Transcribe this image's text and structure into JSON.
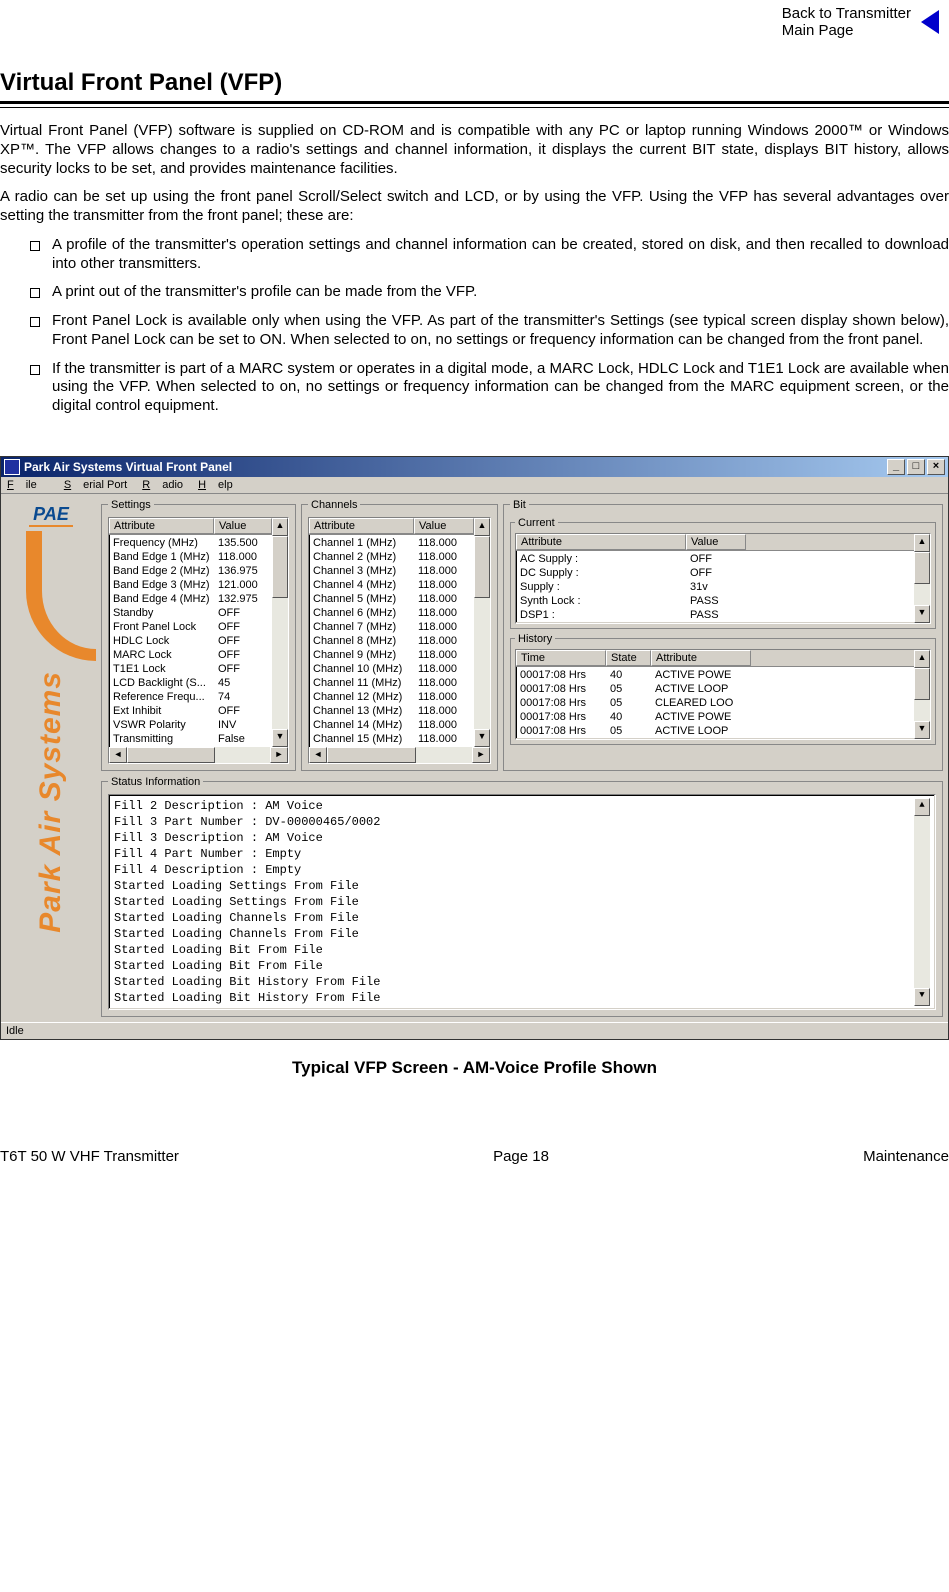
{
  "toplink": {
    "line1": "Back to Transmitter",
    "line2": "Main Page"
  },
  "title": "Virtual Front Panel (VFP)",
  "para1": "Virtual Front Panel (VFP) software is supplied on CD-ROM and is compatible with any PC or laptop running Windows 2000™ or Windows XP™. The VFP allows changes to a radio's settings and channel information, it displays the current BIT state, displays BIT history, allows security locks to be set, and provides maintenance facilities.",
  "para2": "A radio can be set up using the front panel Scroll/Select switch and LCD, or by using the VFP. Using the VFP has several advantages over setting the transmitter from the front panel; these are:",
  "bullets": [
    "A profile of the transmitter's operation settings and channel information can be created, stored on disk, and then recalled to download into other transmitters.",
    "A print out of the transmitter's profile can be made from the VFP.",
    "Front Panel Lock is available only when using the VFP. As part of the transmitter's Settings (see typical screen display shown below), Front Panel Lock can be set to ON. When selected to on, no settings or frequency information can be changed from the front panel.",
    "If the transmitter is part of a MARC system or operates in a digital mode, a MARC Lock, HDLC Lock and T1E1 Lock are available when using the VFP. When selected to on, no settings or frequency information can be changed from the MARC equipment screen, or the digital control equipment."
  ],
  "app": {
    "title": "Park Air Systems Virtual Front Panel",
    "menu": {
      "file": "File",
      "serial": "Serial Port",
      "radio": "Radio",
      "help": "Help"
    },
    "sidebar": {
      "logo": "PAE",
      "brand": "Park Air Systems"
    },
    "settings": {
      "legend": "Settings",
      "headA": "Attribute",
      "headB": "Value",
      "rows": [
        {
          "a": "Frequency (MHz)",
          "b": "135.500"
        },
        {
          "a": "Band Edge 1 (MHz)",
          "b": "118.000"
        },
        {
          "a": "Band Edge 2 (MHz)",
          "b": "136.975"
        },
        {
          "a": "Band Edge 3 (MHz)",
          "b": "121.000"
        },
        {
          "a": "Band Edge 4 (MHz)",
          "b": "132.975"
        },
        {
          "a": "Standby",
          "b": "OFF"
        },
        {
          "a": "Front Panel Lock",
          "b": "OFF"
        },
        {
          "a": "HDLC Lock",
          "b": "OFF"
        },
        {
          "a": "MARC Lock",
          "b": "OFF"
        },
        {
          "a": "T1E1 Lock",
          "b": "OFF"
        },
        {
          "a": "LCD Backlight (S...",
          "b": "45"
        },
        {
          "a": "Reference Frequ...",
          "b": "74"
        },
        {
          "a": "Ext Inhibit",
          "b": "OFF"
        },
        {
          "a": "VSWR Polarity",
          "b": "INV"
        },
        {
          "a": "Transmitting",
          "b": "False"
        }
      ]
    },
    "channels": {
      "legend": "Channels",
      "headA": "Attribute",
      "headB": "Value",
      "rows": [
        {
          "a": "Channel 1   (MHz)",
          "b": "118.000"
        },
        {
          "a": "Channel 2   (MHz)",
          "b": "118.000"
        },
        {
          "a": "Channel 3   (MHz)",
          "b": "118.000"
        },
        {
          "a": "Channel 4   (MHz)",
          "b": "118.000"
        },
        {
          "a": "Channel 5   (MHz)",
          "b": "118.000"
        },
        {
          "a": "Channel 6   (MHz)",
          "b": "118.000"
        },
        {
          "a": "Channel 7   (MHz)",
          "b": "118.000"
        },
        {
          "a": "Channel 8   (MHz)",
          "b": "118.000"
        },
        {
          "a": "Channel 9   (MHz)",
          "b": "118.000"
        },
        {
          "a": "Channel 10 (MHz)",
          "b": "118.000"
        },
        {
          "a": "Channel 11 (MHz)",
          "b": "118.000"
        },
        {
          "a": "Channel 12 (MHz)",
          "b": "118.000"
        },
        {
          "a": "Channel 13 (MHz)",
          "b": "118.000"
        },
        {
          "a": "Channel 14 (MHz)",
          "b": "118.000"
        },
        {
          "a": "Channel 15 (MHz)",
          "b": "118.000"
        }
      ]
    },
    "bit": {
      "legend": "Bit",
      "current": {
        "legend": "Current",
        "headA": "Attribute",
        "headB": "Value",
        "rows": [
          {
            "a": "AC Supply :",
            "b": "OFF"
          },
          {
            "a": "DC Supply :",
            "b": "OFF"
          },
          {
            "a": "Supply :",
            "b": "31v"
          },
          {
            "a": "Synth Lock :",
            "b": "PASS"
          },
          {
            "a": "DSP1 :",
            "b": "PASS"
          }
        ]
      },
      "history": {
        "legend": "History",
        "headA": "Time",
        "headB": "State",
        "headC": "Attribute",
        "rows": [
          {
            "a": "00017:08 Hrs",
            "b": "40",
            "c": "ACTIVE POWE"
          },
          {
            "a": "00017:08 Hrs",
            "b": "05",
            "c": "ACTIVE LOOP"
          },
          {
            "a": "00017:08 Hrs",
            "b": "05",
            "c": "CLEARED LOO"
          },
          {
            "a": "00017:08 Hrs",
            "b": "40",
            "c": "ACTIVE POWE"
          },
          {
            "a": "00017:08 Hrs",
            "b": "05",
            "c": "ACTIVE LOOP"
          }
        ]
      }
    },
    "status": {
      "legend": "Status Information",
      "lines": [
        "Fill 2 Description : AM Voice",
        "Fill 3 Part Number : DV-00000465/0002",
        "Fill 3 Description : AM Voice",
        "Fill 4 Part Number : Empty",
        "Fill 4 Description : Empty",
        "Started Loading Settings From File",
        "Started Loading Settings From File",
        "Started Loading Channels From File",
        "Started Loading Channels From File",
        "Started Loading Bit From File",
        "Started Loading Bit From File",
        "Started Loading Bit History From File",
        "Started Loading Bit History From File"
      ]
    },
    "statusbar": "Idle"
  },
  "caption": "Typical VFP Screen - AM-Voice Profile Shown",
  "footer": {
    "left": "T6T 50 W VHF Transmitter",
    "center": "Page 18",
    "right": "Maintenance"
  }
}
